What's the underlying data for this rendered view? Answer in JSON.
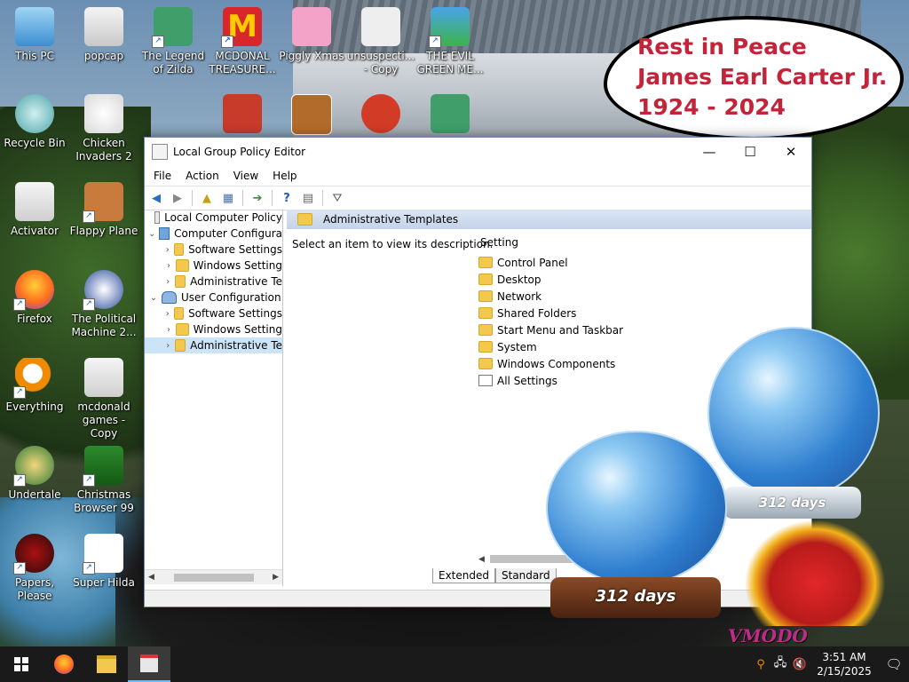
{
  "desktop_icons": [
    {
      "label": "This PC"
    },
    {
      "label": "popcap"
    },
    {
      "label": "The Legend of Zilda"
    },
    {
      "label": "MCDONAL TREASURE..."
    },
    {
      "label": "Piggly Xmas"
    },
    {
      "label": "unsuspecti... - Copy"
    },
    {
      "label": "THE EVIL GREEN ME..."
    },
    {
      "label": "Recycle Bin"
    },
    {
      "label": "Chicken Invaders 2"
    },
    {
      "label": "Activator"
    },
    {
      "label": "Flappy Plane"
    },
    {
      "label": "Firefox"
    },
    {
      "label": "The Political Machine 2..."
    },
    {
      "label": "Everything"
    },
    {
      "label": "mcdonald games - Copy"
    },
    {
      "label": "Undertale"
    },
    {
      "label": "Christmas Browser 99"
    },
    {
      "label": "Papers, Please"
    },
    {
      "label": "Super Hilda"
    }
  ],
  "bubble": {
    "line1": "Rest in Peace",
    "line2": "James Earl Carter Jr.",
    "line3": "1924 - 2024"
  },
  "window": {
    "title": "Local Group Policy Editor",
    "minimize": "—",
    "maximize": "☐",
    "close": "✕",
    "menu": [
      "File",
      "Action",
      "View",
      "Help"
    ],
    "tree": [
      {
        "label": "Local Computer Policy",
        "twisty": ""
      },
      {
        "label": "Computer Configura",
        "twisty": "⌄"
      },
      {
        "label": "Software Settings",
        "twisty": "›"
      },
      {
        "label": "Windows Setting",
        "twisty": "›"
      },
      {
        "label": "Administrative Te",
        "twisty": "›"
      },
      {
        "label": "User Configuration",
        "twisty": "⌄"
      },
      {
        "label": "Software Settings",
        "twisty": "›"
      },
      {
        "label": "Windows Setting",
        "twisty": "›"
      },
      {
        "label": "Administrative Te",
        "twisty": "›"
      }
    ],
    "content_header": "Administrative Templates",
    "description": "Select an item to view its description.",
    "list_header": "Setting",
    "items": [
      "Control Panel",
      "Desktop",
      "Network",
      "Shared Folders",
      "Start Menu and Taskbar",
      "System",
      "Windows Components",
      "All Settings"
    ],
    "tabs": [
      "Extended",
      "Standard"
    ]
  },
  "globes": {
    "left_days": "312 days",
    "right_days": "312 days"
  },
  "watermark": "VMODO",
  "taskbar": {
    "time": "3:51 AM",
    "date": "2/15/2025"
  }
}
